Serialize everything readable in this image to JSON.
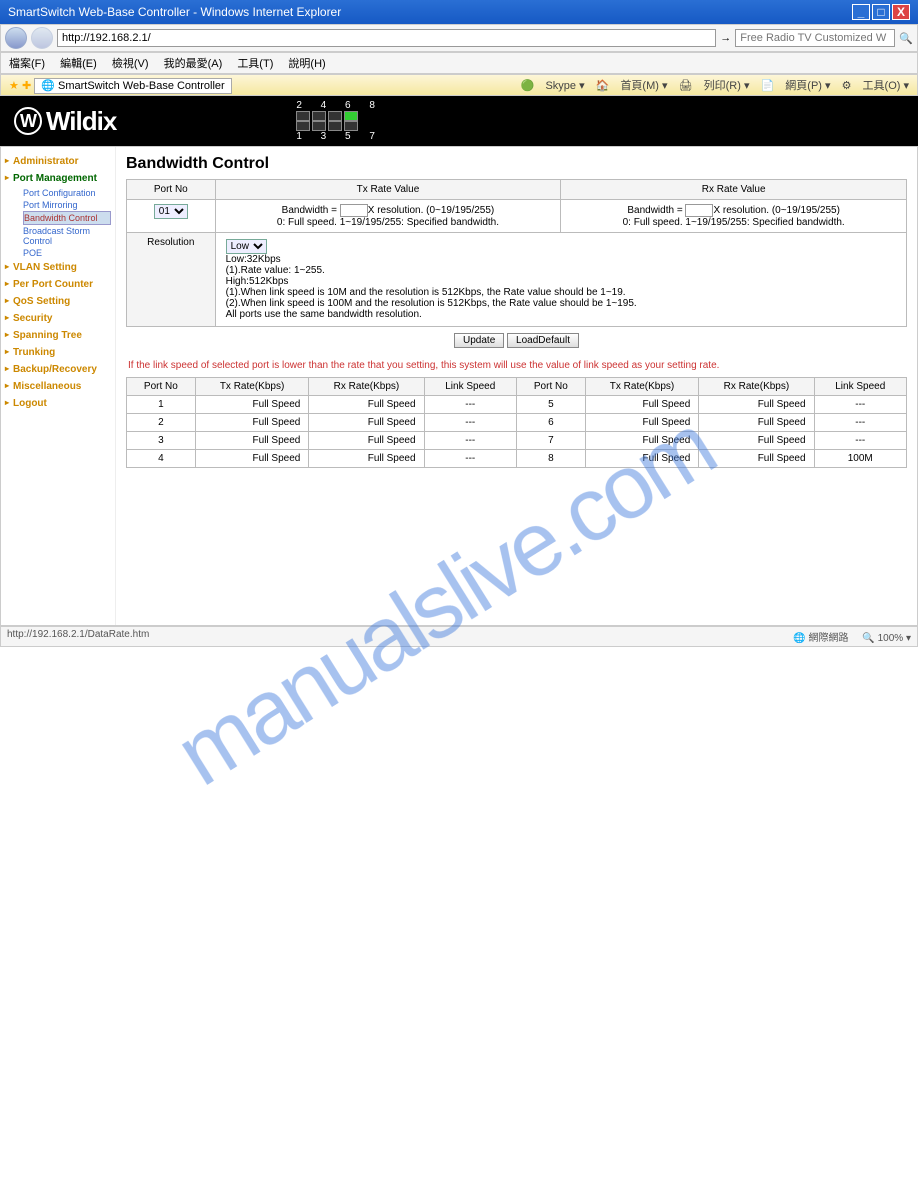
{
  "watermark": "manualslive.com",
  "window": {
    "title": "SmartSwitch Web-Base Controller - Windows Internet Explorer"
  },
  "addr": {
    "url": "http://192.168.2.1/",
    "search_ph": "Free Radio TV Customized W"
  },
  "menu": {
    "a": "檔案(F)",
    "b": "編輯(E)",
    "c": "檢視(V)",
    "d": "我的最愛(A)",
    "e": "工具(T)",
    "f": "說明(H)"
  },
  "tab": {
    "title": "SmartSwitch Web-Base Controller"
  },
  "tools": {
    "skype": "Skype",
    "home": "首頁(M)",
    "print": "列印(R)",
    "page": "網頁(P)",
    "tool": "工具(O)"
  },
  "logo": "Wildix",
  "portnums": {
    "top": "2  4  6  8",
    "bot": "1  3  5  7"
  },
  "nav": {
    "admin": "Administrator",
    "portmgmt": "Port Management",
    "pc": "Port Configuration",
    "pm": "Port Mirroring",
    "bc": "Bandwidth Control",
    "bs": "Broadcast Storm Control",
    "poe": "POE",
    "vlan": "VLAN Setting",
    "ppc": "Per Port Counter",
    "qos": "QoS Setting",
    "sec": "Security",
    "stp": "Spanning Tree",
    "trk": "Trunking",
    "bkp": "Backup/Recovery",
    "misc": "Miscellaneous",
    "logout": "Logout"
  },
  "page": {
    "title": "Bandwidth Control"
  },
  "ctrl": {
    "h_port": "Port No",
    "h_tx": "Tx Rate Value",
    "h_rx": "Rx Rate Value",
    "port_opt": "01",
    "bw_label_a": "Bandwidth = ",
    "bw_label_b": "X resolution. (0~19/195/255)",
    "bw_desc": "0: Full speed. 1~19/195/255: Specified bandwidth.",
    "h_res": "Resolution",
    "res_opt": "Low",
    "res_txt": "Low:32Kbps\n  (1).Rate value: 1~255.\nHigh:512Kbps\n  (1).When link speed is 10M and the resolution is 512Kbps, the Rate value should be 1~19.\n  (2).When link speed is 100M and the resolution is 512Kbps, the Rate value should be 1~195.\nAll ports use the same bandwidth resolution.",
    "btn_upd": "Update",
    "btn_def": "LoadDefault"
  },
  "note": "If the link speed of selected port is lower than the rate that you setting, this system will use the value of link speed as your setting rate.",
  "rates": {
    "h_pn": "Port No",
    "h_tx": "Tx  Rate(Kbps)",
    "h_rx": "Rx  Rate(Kbps)",
    "h_ls": "Link Speed",
    "rows": [
      {
        "p": "1",
        "tx": "Full Speed",
        "rx": "Full Speed",
        "ls": "---"
      },
      {
        "p": "2",
        "tx": "Full Speed",
        "rx": "Full Speed",
        "ls": "---"
      },
      {
        "p": "3",
        "tx": "Full Speed",
        "rx": "Full Speed",
        "ls": "---"
      },
      {
        "p": "4",
        "tx": "Full Speed",
        "rx": "Full Speed",
        "ls": "---"
      },
      {
        "p": "5",
        "tx": "Full Speed",
        "rx": "Full Speed",
        "ls": "---"
      },
      {
        "p": "6",
        "tx": "Full Speed",
        "rx": "Full Speed",
        "ls": "---"
      },
      {
        "p": "7",
        "tx": "Full Speed",
        "rx": "Full Speed",
        "ls": "---"
      },
      {
        "p": "8",
        "tx": "Full Speed",
        "rx": "Full Speed",
        "ls": "100M"
      }
    ]
  },
  "status": {
    "left": "http://192.168.2.1/DataRate.htm",
    "net": "網際網路",
    "zoom": "100%"
  }
}
